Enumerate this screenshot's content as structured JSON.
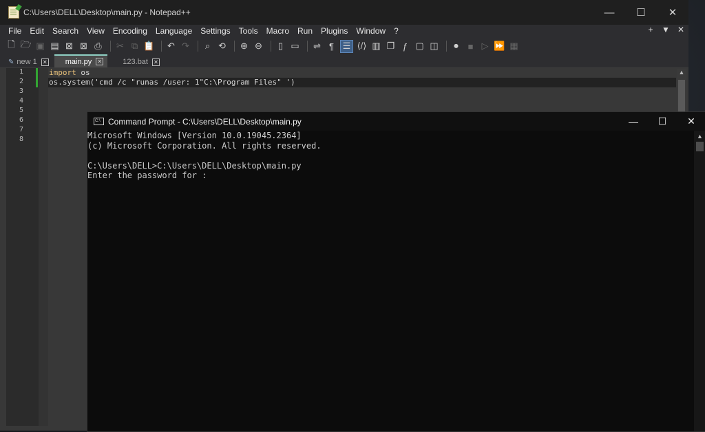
{
  "npp": {
    "title": "C:\\Users\\DELL\\Desktop\\main.py - Notepad++",
    "window_buttons": [
      "—",
      "☐",
      "✕"
    ],
    "menu": [
      "File",
      "Edit",
      "Search",
      "View",
      "Encoding",
      "Language",
      "Settings",
      "Tools",
      "Macro",
      "Run",
      "Plugins",
      "Window",
      "?"
    ],
    "menu_right": [
      "+",
      "▼",
      "✕"
    ],
    "tabs": [
      {
        "label": "new 1",
        "active": false
      },
      {
        "label": "main.py",
        "active": true
      },
      {
        "label": "123.bat",
        "active": false
      }
    ],
    "line_numbers": [
      "1",
      "2",
      "3",
      "4",
      "5",
      "6",
      "7",
      "8"
    ],
    "code": {
      "line1_kw": "import",
      "line1_rest": " os",
      "line2": "os.system('cmd /c \"runas /user: 1\"C:\\Program Files\" ')"
    }
  },
  "cmd": {
    "title": "Command Prompt - C:\\Users\\DELL\\Desktop\\main.py",
    "icon_text": "C:\\",
    "window_buttons": [
      "—",
      "☐",
      "✕"
    ],
    "lines": [
      "Microsoft Windows [Version 10.0.19045.2364]",
      "(c) Microsoft Corporation. All rights reserved.",
      "",
      "C:\\Users\\DELL>C:\\Users\\DELL\\Desktop\\main.py",
      "Enter the password for :"
    ]
  },
  "icons": {
    "toolbar": [
      "new-file-icon",
      "open-file-icon",
      "save-icon",
      "save-all-icon",
      "close-icon",
      "close-all-icon",
      "print-icon",
      "cut-icon",
      "copy-icon",
      "paste-icon",
      "undo-icon",
      "redo-icon",
      "find-icon",
      "replace-icon",
      "zoom-in-icon",
      "zoom-out-icon",
      "sync-vertical-icon",
      "sync-horizontal-icon",
      "word-wrap-icon",
      "show-all-chars-icon",
      "indent-guide-icon",
      "xml-tag-icon",
      "document-map-icon",
      "clone-icon",
      "function-list-icon",
      "monitor-icon",
      "folder-workspace-icon",
      "record-macro-icon",
      "stop-record-icon",
      "play-macro-icon",
      "run-macro-multiple-icon",
      "save-macro-icon"
    ]
  }
}
